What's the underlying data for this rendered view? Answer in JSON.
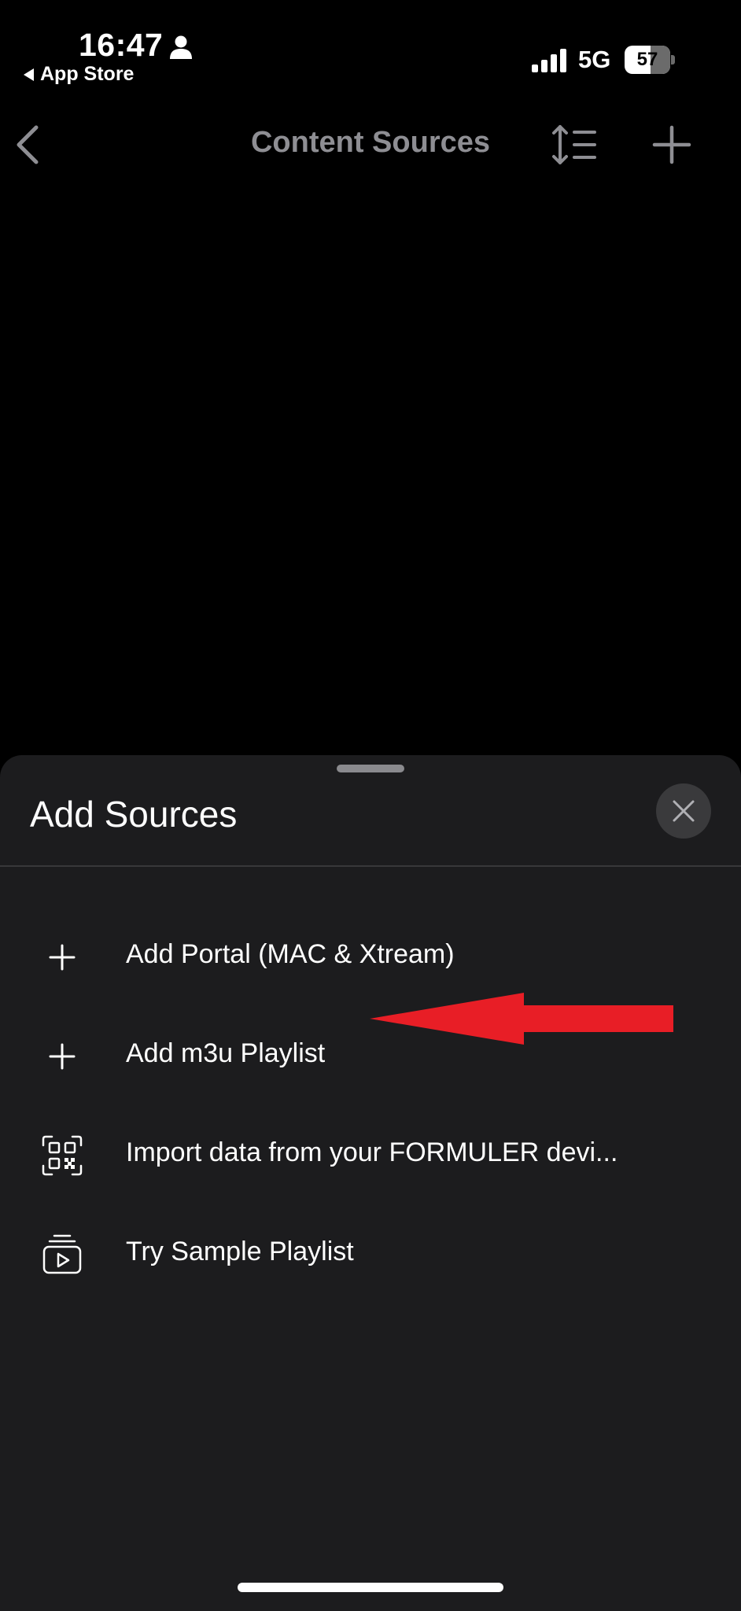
{
  "status_bar": {
    "time": "16:47",
    "back_app": "App Store",
    "network": "5G",
    "battery": "57",
    "battery_level": 0.57
  },
  "nav": {
    "title": "Content Sources",
    "back_icon": "chevron-left-icon",
    "sort_icon": "sort-list-icon",
    "add_icon": "plus-icon"
  },
  "sheet": {
    "title": "Add Sources",
    "close_icon": "close-icon",
    "items": [
      {
        "label": "Add Portal (MAC & Xtream)",
        "icon": "plus-icon"
      },
      {
        "label": "Add m3u Playlist",
        "icon": "plus-icon"
      },
      {
        "label": "Import data from your FORMULER devi...",
        "icon": "qr-code-icon"
      },
      {
        "label": "Try Sample Playlist",
        "icon": "playlist-play-icon"
      }
    ]
  },
  "annotation": {
    "arrow_color": "#e81e26"
  },
  "colors": {
    "background": "#000000",
    "sheet": "#1c1c1e",
    "nav_title": "#8e8e93",
    "close_button": "#3a3a3c"
  }
}
